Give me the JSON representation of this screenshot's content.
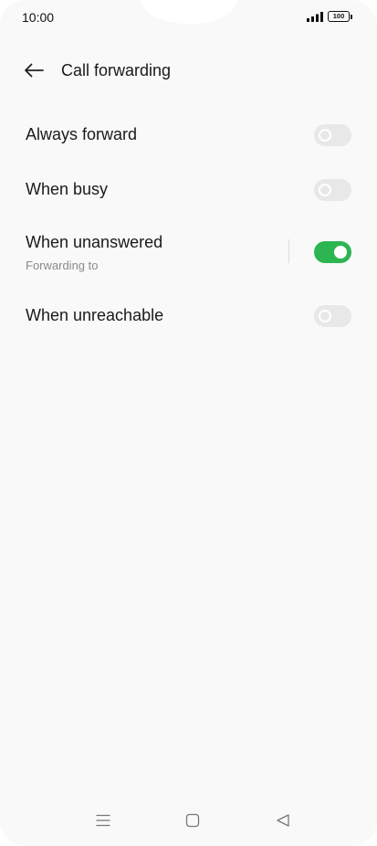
{
  "status_bar": {
    "time": "10:00",
    "battery_level": "100",
    "icons": [
      "signal-icon",
      "battery-icon"
    ]
  },
  "header": {
    "back_icon": "arrow-left-icon",
    "title": "Call forwarding"
  },
  "settings": [
    {
      "title": "Always forward",
      "subtitle": "",
      "enabled": false
    },
    {
      "title": "When busy",
      "subtitle": "",
      "enabled": false
    },
    {
      "title": "When unanswered",
      "subtitle": "Forwarding to",
      "enabled": true
    },
    {
      "title": "When unreachable",
      "subtitle": "",
      "enabled": false
    }
  ],
  "nav_bar": {
    "icons": [
      "menu-icon",
      "home-icon",
      "back-triangle-icon"
    ]
  },
  "colors": {
    "toggle_on": "#2db552",
    "toggle_off": "#e8e8e8",
    "background": "#f9f9f9"
  }
}
